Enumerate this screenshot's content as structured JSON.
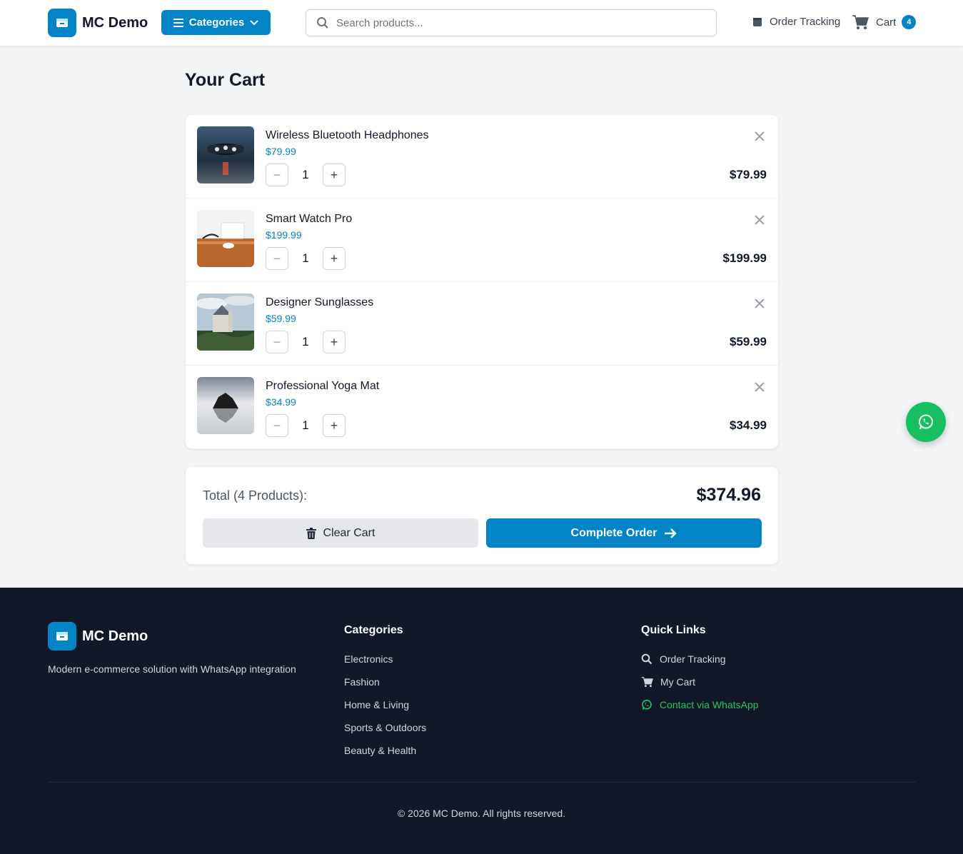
{
  "header": {
    "brand": "MC Demo",
    "categories_label": "Categories",
    "search_placeholder": "Search products...",
    "order_tracking_label": "Order Tracking",
    "cart_label": "Cart",
    "cart_count": "4"
  },
  "page_title": "Your Cart",
  "cart": {
    "items": [
      {
        "name": "Wireless Bluetooth Headphones",
        "price": "$79.99",
        "qty": "1",
        "line_total": "$79.99",
        "image": "headphones-photo"
      },
      {
        "name": "Smart Watch Pro",
        "price": "$199.99",
        "qty": "1",
        "line_total": "$199.99",
        "image": "desk-watch-photo"
      },
      {
        "name": "Designer Sunglasses",
        "price": "$59.99",
        "qty": "1",
        "line_total": "$59.99",
        "image": "castle-landscape-photo"
      },
      {
        "name": "Professional Yoga Mat",
        "price": "$34.99",
        "qty": "1",
        "line_total": "$34.99",
        "image": "rock-lake-photo"
      }
    ]
  },
  "summary": {
    "total_label": "Total (4 Products):",
    "total_value": "$374.96",
    "clear_label": "Clear Cart",
    "complete_label": "Complete Order"
  },
  "footer": {
    "brand": "MC Demo",
    "description": "Modern e-commerce solution with WhatsApp integration",
    "categories_title": "Categories",
    "categories": [
      "Electronics",
      "Fashion",
      "Home & Living",
      "Sports & Outdoors",
      "Beauty & Health"
    ],
    "quick_links_title": "Quick Links",
    "quick_links": [
      "Order Tracking",
      "My Cart",
      "Contact via WhatsApp"
    ],
    "copyright": "© 2026 MC Demo. All rights reserved."
  },
  "colors": {
    "primary": "#0284c7",
    "whatsapp": "#16c060",
    "footer_bg": "#111827",
    "page_bg": "#f3f4f6"
  },
  "icons": [
    "store-icon",
    "menu-icon",
    "chevron-down-icon",
    "search-icon",
    "box-icon",
    "cart-icon",
    "close-icon",
    "minus-icon",
    "plus-icon",
    "trash-icon",
    "arrow-right-icon",
    "whatsapp-icon"
  ]
}
